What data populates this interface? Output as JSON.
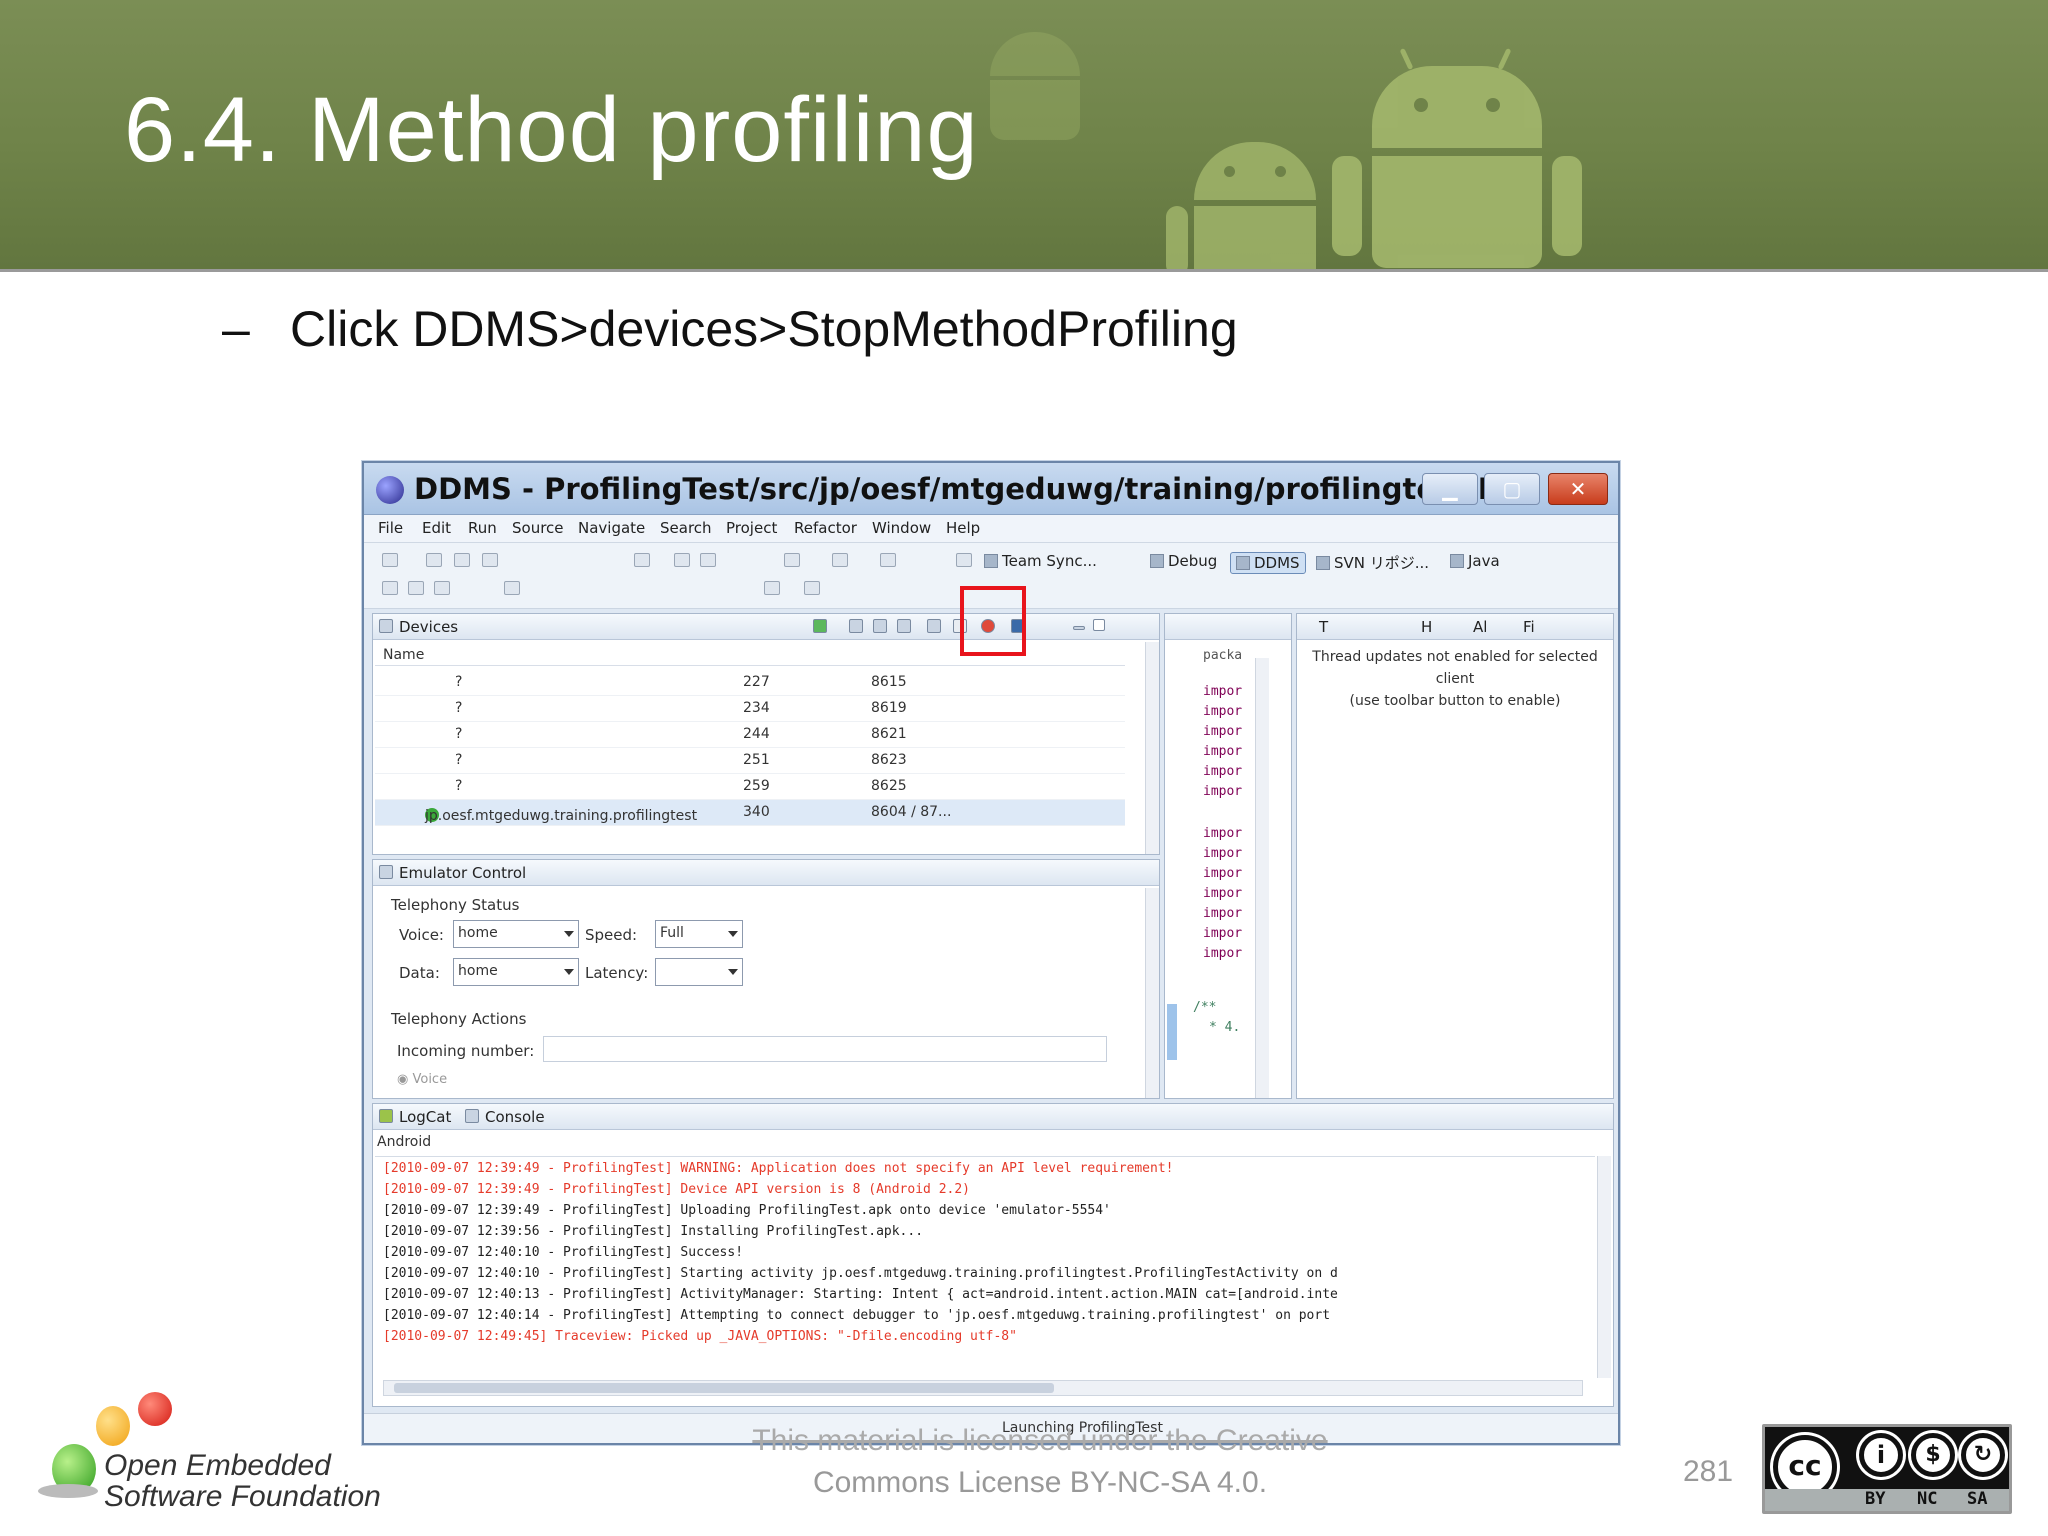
{
  "slide": {
    "title": "6.4. Method profiling",
    "bullet_dash": "–",
    "bullet": "Click DDMS>devices>StopMethodProfiling",
    "page_number": "281",
    "license_line1": "This material is licensed under the Creative",
    "license_line2": "Commons License BY-NC-SA 4.0.",
    "logo_line1": "Open Embedded",
    "logo_line2": "Software Foundation",
    "cc_labels": [
      "BY",
      "NC",
      "SA"
    ],
    "cc_circle_text": [
      "cc",
      "i",
      "$",
      "↻"
    ],
    "highlight_color": "#e8141c",
    "banner_color": "#6f8349"
  },
  "window": {
    "title": "DDMS - ProfilingTest/src/jp/oesf/mtgeduwg/training/profilingtest/Pr...",
    "menu": [
      "File",
      "Edit",
      "Run",
      "Source",
      "Navigate",
      "Search",
      "Project",
      "Refactor",
      "Window",
      "Help"
    ],
    "perspectives": [
      "Team Sync...",
      "Debug",
      "DDMS",
      "SVN リポジ...",
      "Java"
    ],
    "close_glyph": "✕",
    "devices": {
      "tab": "Devices",
      "column": "Name",
      "rows": [
        {
          "name": "?",
          "pid": "227",
          "port": "8615"
        },
        {
          "name": "?",
          "pid": "234",
          "port": "8619"
        },
        {
          "name": "?",
          "pid": "244",
          "port": "8621"
        },
        {
          "name": "?",
          "pid": "251",
          "port": "8623"
        },
        {
          "name": "?",
          "pid": "259",
          "port": "8625"
        },
        {
          "name": "jp.oesf.mtgeduwg.training.profilingtest",
          "pid": "340",
          "port": "8604 / 87..."
        }
      ]
    },
    "emulator": {
      "tab": "Emulator Control",
      "telephony_status": "Telephony Status",
      "voice_label": "Voice:",
      "voice_value": "home",
      "speed_label": "Speed:",
      "speed_value": "Full",
      "data_label": "Data:",
      "data_value": "home",
      "latency_label": "Latency:",
      "latency_value": "",
      "telephony_actions": "Telephony Actions",
      "incoming_label": "Incoming number:",
      "voice_radio": "Voice"
    },
    "outline": {
      "header": "packa",
      "lines": [
        "impor",
        "impor",
        "impor",
        "impor",
        "impor",
        "impor",
        "impor",
        "impor",
        "impor",
        "impor",
        "impor",
        "impor",
        "impor"
      ],
      "comment": "/**",
      "comment2": "* 4."
    },
    "threads": {
      "tabs": [
        "T",
        "H",
        "Al",
        "Fi"
      ],
      "message1": "Thread updates not enabled for selected",
      "message2": "client",
      "message3": "(use toolbar button to enable)"
    },
    "console": {
      "tabs": [
        "LogCat",
        "Console"
      ],
      "source": "Android",
      "lines": [
        {
          "text": "[2010-09-07 12:39:49 - ProfilingTest] WARNING: Application does not specify an API level requirement!",
          "color": "red"
        },
        {
          "text": "[2010-09-07 12:39:49 - ProfilingTest] Device API version is 8 (Android 2.2)",
          "color": "red"
        },
        {
          "text": "[2010-09-07 12:39:49 - ProfilingTest] Uploading ProfilingTest.apk onto device 'emulator-5554'",
          "color": "black"
        },
        {
          "text": "[2010-09-07 12:39:56 - ProfilingTest] Installing ProfilingTest.apk...",
          "color": "black"
        },
        {
          "text": "[2010-09-07 12:40:10 - ProfilingTest] Success!",
          "color": "black"
        },
        {
          "text": "[2010-09-07 12:40:10 - ProfilingTest] Starting activity jp.oesf.mtgeduwg.training.profilingtest.ProfilingTestActivity on d",
          "color": "black"
        },
        {
          "text": "[2010-09-07 12:40:13 - ProfilingTest] ActivityManager: Starting: Intent { act=android.intent.action.MAIN cat=[android.inte",
          "color": "black"
        },
        {
          "text": "[2010-09-07 12:40:14 - ProfilingTest] Attempting to connect debugger to 'jp.oesf.mtgeduwg.training.profilingtest' on port",
          "color": "black"
        },
        {
          "text": "[2010-09-07 12:49:45] Traceview: Picked up _JAVA_OPTIONS: \"-Dfile.encoding utf-8\"",
          "color": "red"
        }
      ]
    },
    "status": "Launching ProfilingTest"
  }
}
